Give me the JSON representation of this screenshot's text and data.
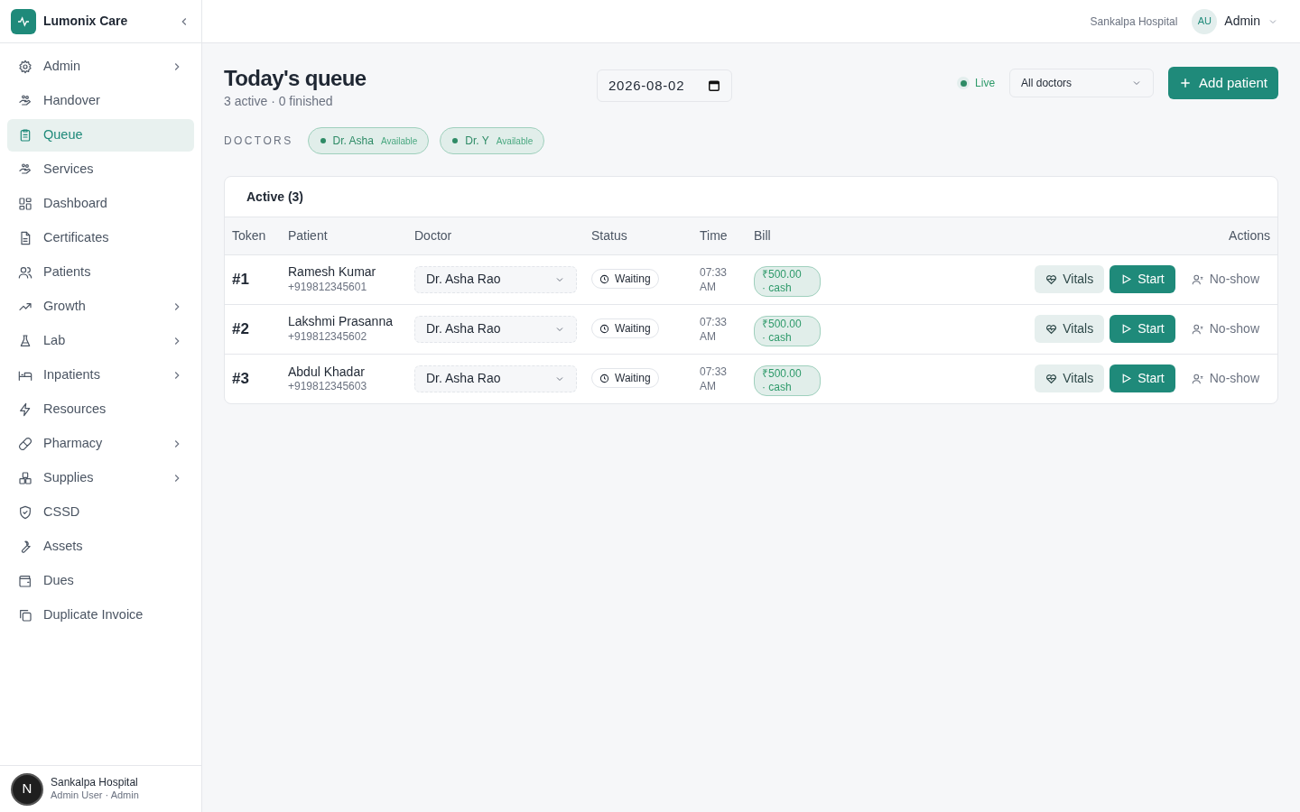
{
  "brand": {
    "name": "Lumonix Care"
  },
  "sidebar": {
    "items": [
      {
        "label": "Admin",
        "expandable": true,
        "selected": false
      },
      {
        "label": "Handover",
        "expandable": false,
        "selected": false
      },
      {
        "label": "Queue",
        "expandable": false,
        "selected": true
      },
      {
        "label": "Services",
        "expandable": false,
        "selected": false
      },
      {
        "label": "Dashboard",
        "expandable": false,
        "selected": false
      },
      {
        "label": "Certificates",
        "expandable": false,
        "selected": false
      },
      {
        "label": "Patients",
        "expandable": false,
        "selected": false
      },
      {
        "label": "Growth",
        "expandable": true,
        "selected": false
      },
      {
        "label": "Lab",
        "expandable": true,
        "selected": false
      },
      {
        "label": "Inpatients",
        "expandable": true,
        "selected": false
      },
      {
        "label": "Resources",
        "expandable": false,
        "selected": false
      },
      {
        "label": "Pharmacy",
        "expandable": true,
        "selected": false
      },
      {
        "label": "Supplies",
        "expandable": true,
        "selected": false
      },
      {
        "label": "CSSD",
        "expandable": false,
        "selected": false
      },
      {
        "label": "Assets",
        "expandable": false,
        "selected": false
      },
      {
        "label": "Dues",
        "expandable": false,
        "selected": false
      },
      {
        "label": "Duplicate Invoice",
        "expandable": false,
        "selected": false
      }
    ],
    "footer": {
      "title": "Sankalpa Hospital",
      "subtitle": "Admin User · Admin"
    }
  },
  "dev_badge": "N",
  "topbar": {
    "hospital": "Sankalpa Hospital",
    "avatar": "AU",
    "user": "Admin"
  },
  "page": {
    "title": "Today's queue",
    "subtitle": "3 active · 0 finished",
    "date": "2026-08-02",
    "live": "Live",
    "doctor_filter": "All doctors",
    "add_button": "Add patient"
  },
  "doctors": {
    "label": "DOCTORS",
    "items": [
      {
        "name": "Dr. Asha",
        "status": "Available"
      },
      {
        "name": "Dr. Y",
        "status": "Available"
      }
    ]
  },
  "table": {
    "title": "Active (3)",
    "columns": [
      "Token",
      "Patient",
      "Doctor",
      "Status",
      "Time",
      "Bill",
      "Actions"
    ],
    "rows": [
      {
        "token": "#1",
        "patient": "Ramesh Kumar",
        "phone": "+919812345601",
        "doctor": "Dr. Asha Rao",
        "status": "Waiting",
        "time": "07:33 AM",
        "amount": "₹500.00",
        "method": "· cash",
        "actions": [
          "Vitals",
          "Start",
          "No-show"
        ]
      },
      {
        "token": "#2",
        "patient": "Lakshmi Prasanna",
        "phone": "+919812345602",
        "doctor": "Dr. Asha Rao",
        "status": "Waiting",
        "time": "07:33 AM",
        "amount": "₹500.00",
        "method": "· cash",
        "actions": [
          "Vitals",
          "Start",
          "No-show"
        ]
      },
      {
        "token": "#3",
        "patient": "Abdul Khadar",
        "phone": "+919812345603",
        "doctor": "Dr. Asha Rao",
        "status": "Waiting",
        "time": "07:33 AM",
        "amount": "₹500.00",
        "method": "· cash",
        "actions": [
          "Vitals",
          "Start",
          "No-show"
        ]
      }
    ]
  }
}
